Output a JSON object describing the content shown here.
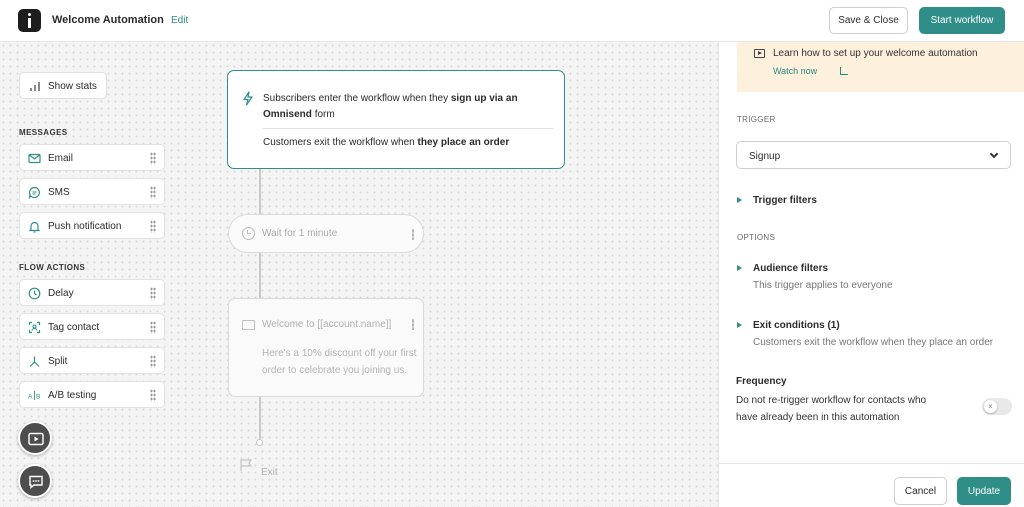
{
  "header": {
    "title": "Welcome Automation",
    "edit_label": "Edit",
    "save_close_label": "Save & Close",
    "start_workflow_label": "Start workflow"
  },
  "palette": {
    "show_stats_label": "Show stats",
    "messages_heading": "MESSAGES",
    "messages": [
      {
        "label": "Email",
        "icon": "email-icon"
      },
      {
        "label": "SMS",
        "icon": "sms-icon"
      },
      {
        "label": "Push notification",
        "icon": "bell-icon"
      }
    ],
    "flow_actions_heading": "FLOW ACTIONS",
    "flow_actions": [
      {
        "label": "Delay",
        "icon": "clock-icon"
      },
      {
        "label": "Tag contact",
        "icon": "tag-icon"
      },
      {
        "label": "Split",
        "icon": "split-icon"
      },
      {
        "label": "A/B testing",
        "icon": "ab-icon"
      }
    ]
  },
  "flow": {
    "trigger_pre": "Subscribers enter the workflow when they ",
    "trigger_bold": "sign up via an Omnisend",
    "trigger_post": "form",
    "exit_pre": "Customers exit the workflow when ",
    "exit_bold": "they place an order",
    "wait_label": "Wait for 1 minute",
    "email_title": "Welcome to [[account.name]]",
    "email_body": "Here's a 10% discount off your first order to celebrate you joining us.",
    "exit_label": "Exit"
  },
  "panel": {
    "learn_text": "Learn how to set up your welcome automation",
    "watch_now": "Watch now",
    "trigger_heading": "TRIGGER",
    "trigger_value": "Signup",
    "trigger_filters": "Trigger filters",
    "options_heading": "OPTIONS",
    "audience_title": "Audience filters",
    "audience_sub": "This trigger applies to everyone",
    "exit_title": "Exit conditions (1)",
    "exit_sub": "Customers exit the workflow when they place an order",
    "frequency_title": "Frequency",
    "frequency_text": "Do not re-trigger workflow for contacts who have already been in this automation",
    "frequency_enabled": false,
    "cancel_label": "Cancel",
    "update_label": "Update"
  },
  "colors": {
    "accent": "#2f8f88",
    "banner": "#fdf1dd"
  }
}
